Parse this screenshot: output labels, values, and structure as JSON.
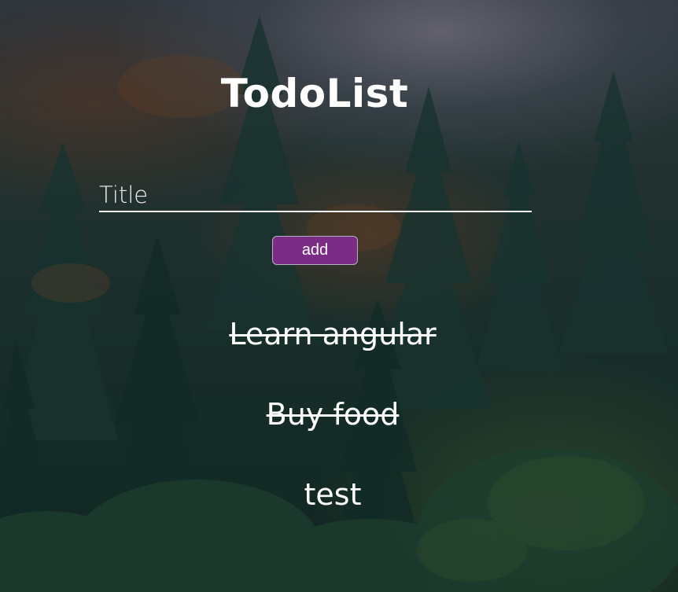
{
  "app": {
    "title": "TodoList"
  },
  "form": {
    "title_placeholder": "Title",
    "title_value": "",
    "add_label": "add"
  },
  "todos": [
    {
      "text": "Learn angular",
      "done": true
    },
    {
      "text": "Buy food",
      "done": true
    },
    {
      "text": "test",
      "done": false
    }
  ],
  "colors": {
    "button": "#7b2d85",
    "text": "#ffffff"
  }
}
